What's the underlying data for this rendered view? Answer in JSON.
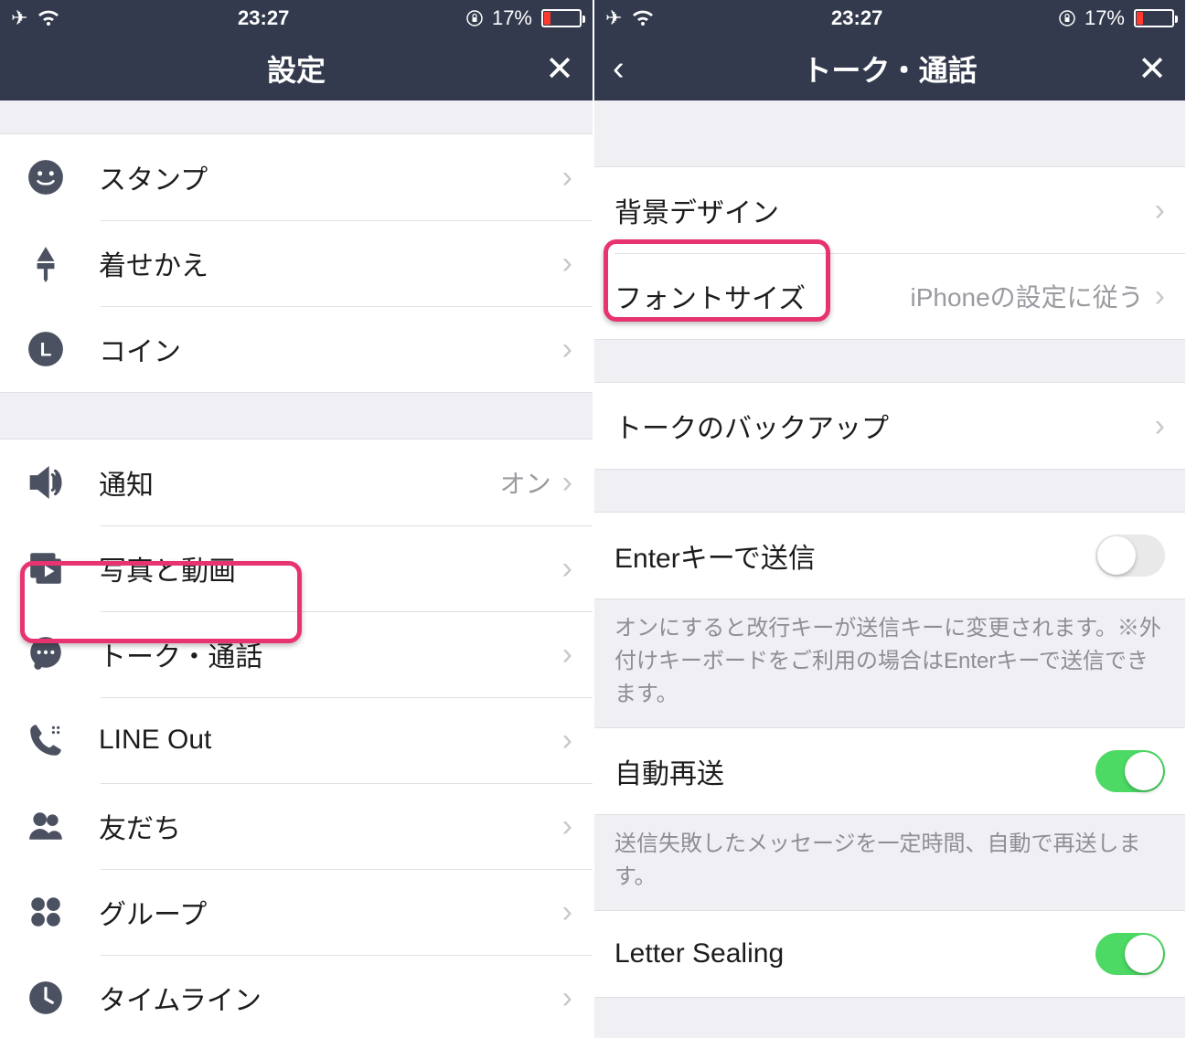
{
  "status": {
    "time": "23:27",
    "battery": "17%"
  },
  "left": {
    "title": "設定",
    "section1": [
      {
        "icon": "smile",
        "label": "スタンプ"
      },
      {
        "icon": "brush",
        "label": "着せかえ"
      },
      {
        "icon": "lcoin",
        "label": "コイン"
      }
    ],
    "section2": [
      {
        "icon": "speaker",
        "label": "通知",
        "value": "オン"
      },
      {
        "icon": "photos",
        "label": "写真と動画"
      },
      {
        "icon": "chat",
        "label": "トーク・通話"
      },
      {
        "icon": "phone",
        "label": "LINE Out"
      },
      {
        "icon": "friends",
        "label": "友だち"
      },
      {
        "icon": "dots4",
        "label": "グループ"
      },
      {
        "icon": "clock",
        "label": "タイムライン"
      }
    ]
  },
  "right": {
    "title": "トーク・通話",
    "sectionA": [
      {
        "label": "背景デザイン"
      },
      {
        "label": "フォントサイズ",
        "value": "iPhoneの設定に従う"
      }
    ],
    "sectionB": [
      {
        "label": "トークのバックアップ"
      }
    ],
    "enterSend": {
      "label": "Enterキーで送信",
      "on": false,
      "hint": "オンにすると改行キーが送信キーに変更されます。※外付けキーボードをご利用の場合はEnterキーで送信できます。"
    },
    "autoResend": {
      "label": "自動再送",
      "on": true,
      "hint": "送信失敗したメッセージを一定時間、自動で再送します。"
    },
    "letterSealing": {
      "label": "Letter Sealing",
      "on": true
    }
  }
}
